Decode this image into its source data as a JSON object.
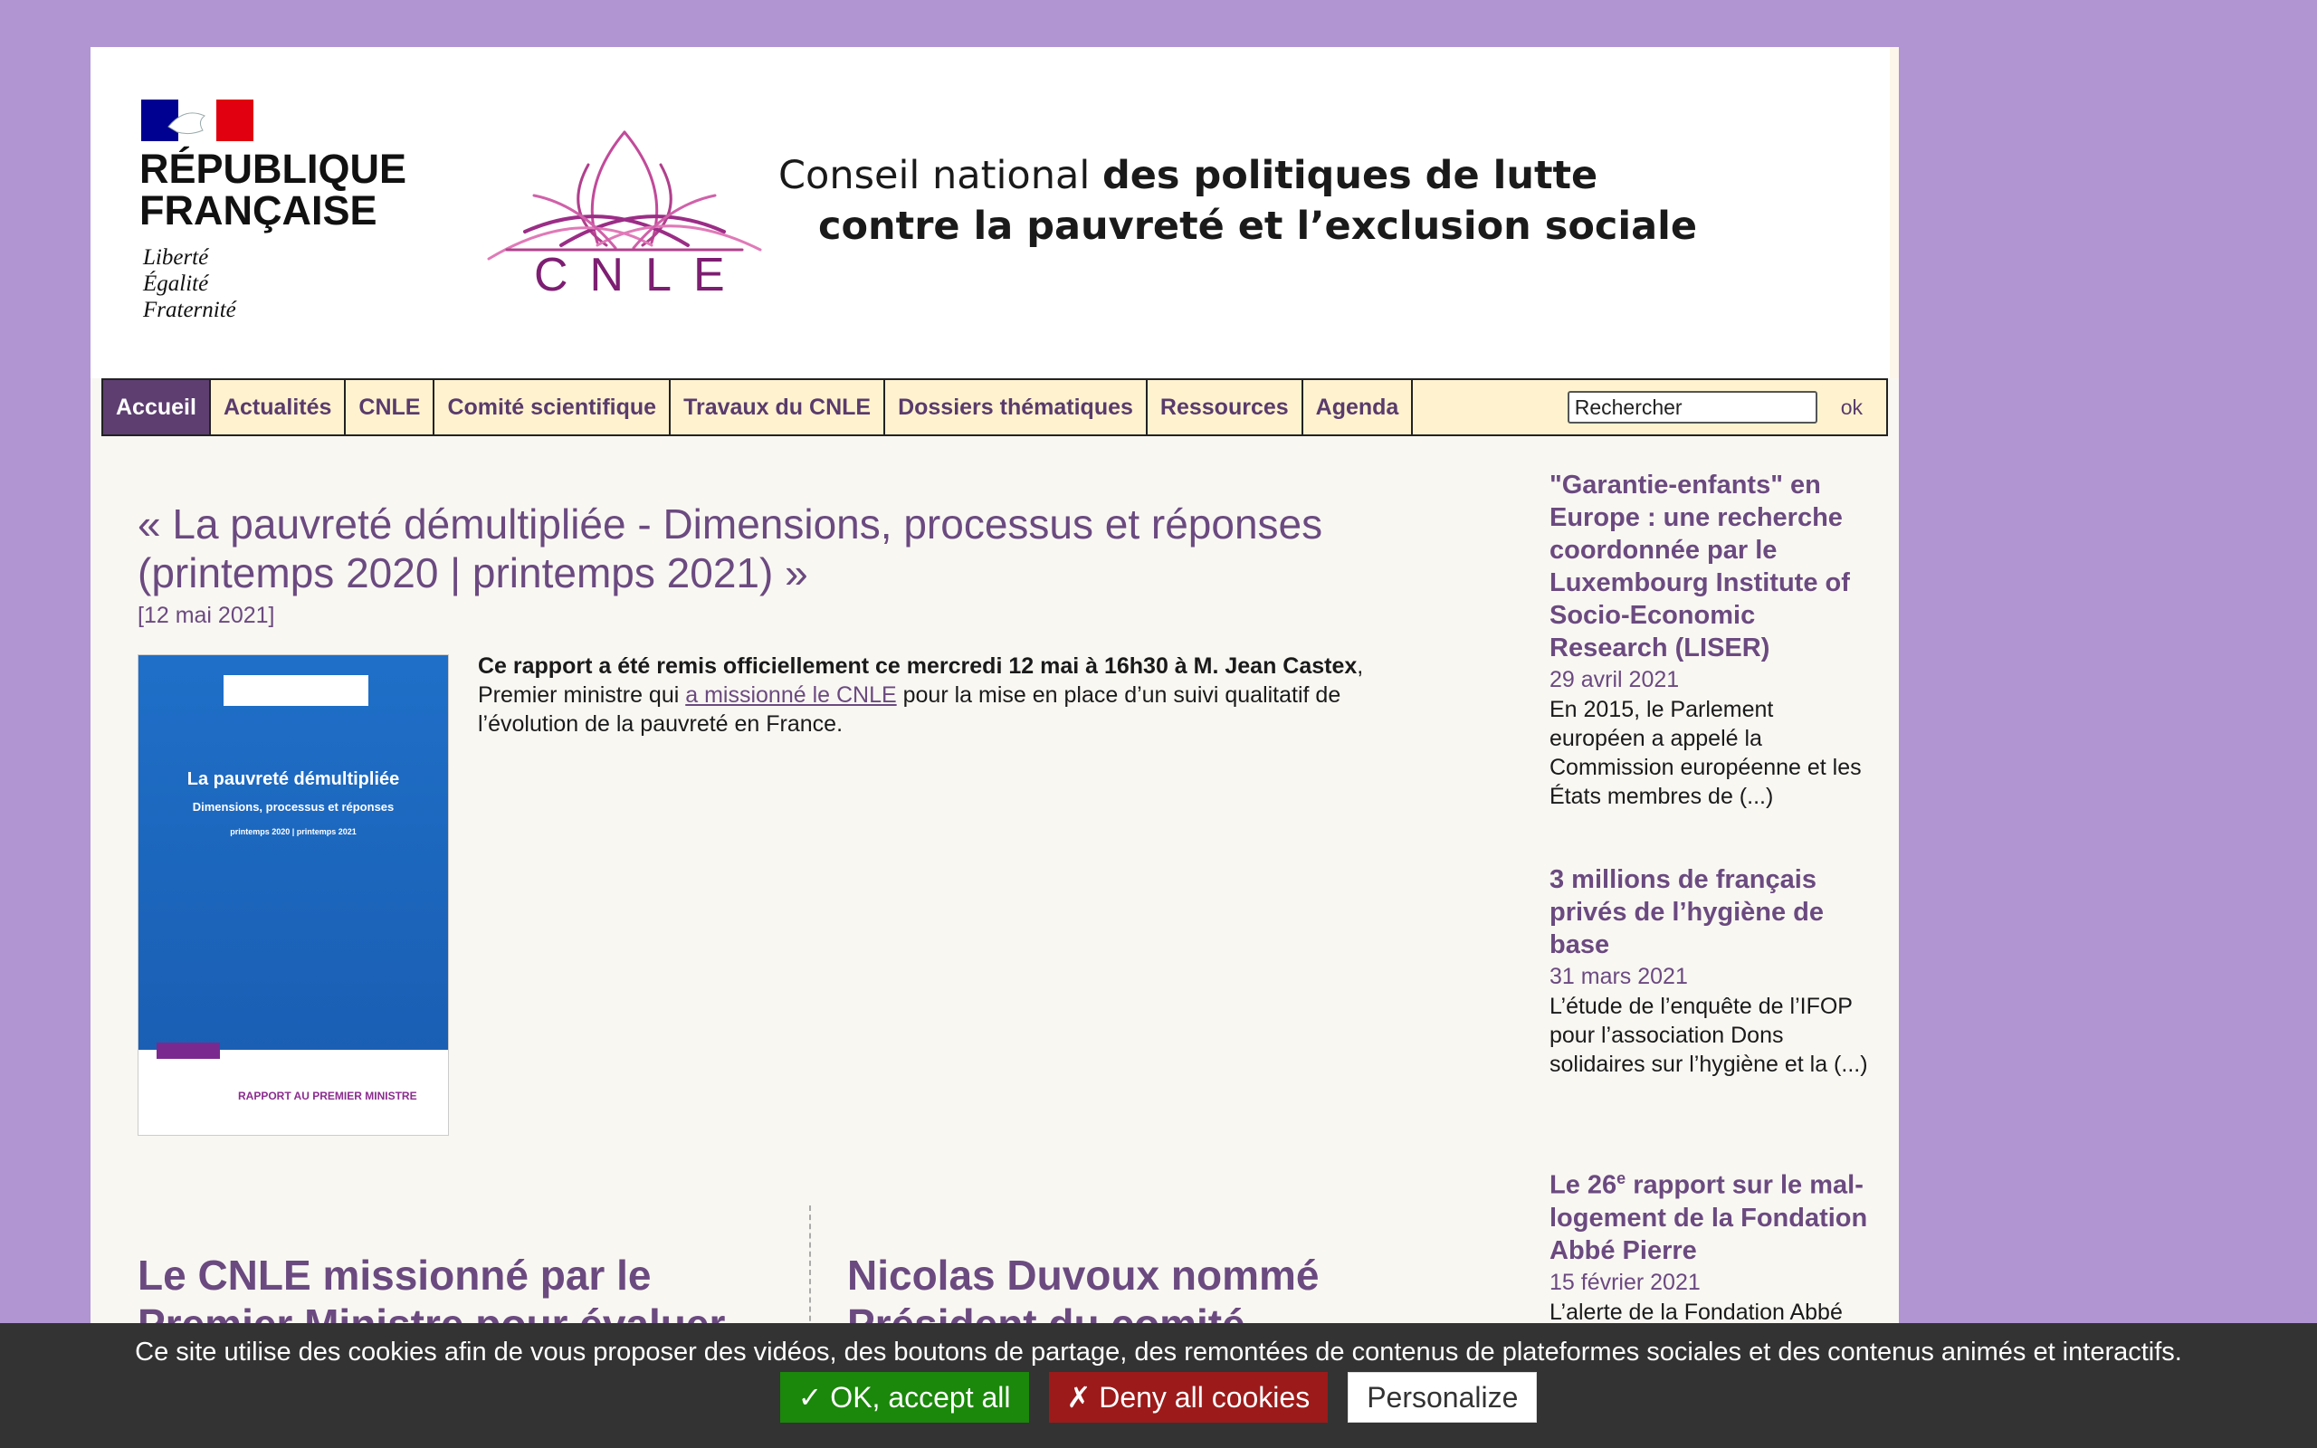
{
  "header": {
    "republique": [
      "RÉPUBLIQUE",
      "FRANÇAISE"
    ],
    "motto": [
      "Liberté",
      "Égalité",
      "Fraternité"
    ],
    "cnle_letters": "CNLE",
    "conseil_line1_plain": "Conseil national ",
    "conseil_line1_bold": "des politiques de lutte",
    "conseil_line2_bold": "contre la pauvreté et l’exclusion sociale",
    "colors": {
      "marianne_blue": "#000091",
      "marianne_red": "#e1000f",
      "cnle_purple": "#7d1e72"
    }
  },
  "nav": {
    "items": [
      "Accueil",
      "Actualités",
      "CNLE",
      "Comité scientifique",
      "Travaux du CNLE",
      "Dossiers thématiques",
      "Ressources",
      "Agenda"
    ],
    "active": "Accueil",
    "search_value": "Rechercher",
    "search_ok": "ok"
  },
  "main": {
    "title_line1": "« La pauvreté démultipliée - Dimensions, processus et réponses",
    "title_line2": "(printemps 2020 | printemps 2021) »",
    "date": "[12 mai 2021]",
    "intro_bold": "Ce rapport a été remis officiellement ce mercredi 12 mai à 16h30 à M. Jean Castex",
    "intro_after_bold": ", Premier ministre qui ",
    "intro_link": "a missionné le CNLE",
    "intro_rest": " pour la mise en place d’un suivi qualitatif de l’évolution de la pauvreté en France.",
    "cover": {
      "title": "La pauvreté démultipliée",
      "subtitle": "Dimensions, processus et réponses",
      "period": "printemps 2020 | printemps 2021",
      "report": "RAPPORT AU PREMIER MINISTRE"
    }
  },
  "columns": {
    "left_title": "Le CNLE missionné par le Premier Ministre pour évaluer",
    "right_title": "Nicolas Duvoux nommé Président du comité scientifique"
  },
  "sidebar": {
    "items": [
      {
        "title": "\"Garantie-enfants\" en Europe : une recherche coordonnée par le Luxembourg Institute of Socio-Economic Research (LISER)",
        "date": "29 avril 2021",
        "text": "En 2015, le Parlement européen a appelé la Commission européenne et les États membres de (...)"
      },
      {
        "title": "3 millions de français privés de l’hygiène de base",
        "date": "31 mars 2021",
        "text": "L’étude de l’enquête de l’IFOP pour l’association Dons solidaires sur l’hygiène et la (...)"
      },
      {
        "title_pre": "Le 26",
        "title_sup": "e",
        "title_post": " rapport sur le mal-logement de la Fondation Abbé Pierre",
        "date": "15 février 2021",
        "text": "L’alerte de la Fondation Abbé"
      }
    ]
  },
  "cookie": {
    "message": "Ce site utilise des cookies afin de vous proposer des vidéos, des boutons de partage, des remontées de contenus de plateformes sociales et des contenus animés et interactifs.",
    "ok": "✓ OK, accept all",
    "deny": "✗ Deny all cookies",
    "personalize": "Personalize"
  }
}
